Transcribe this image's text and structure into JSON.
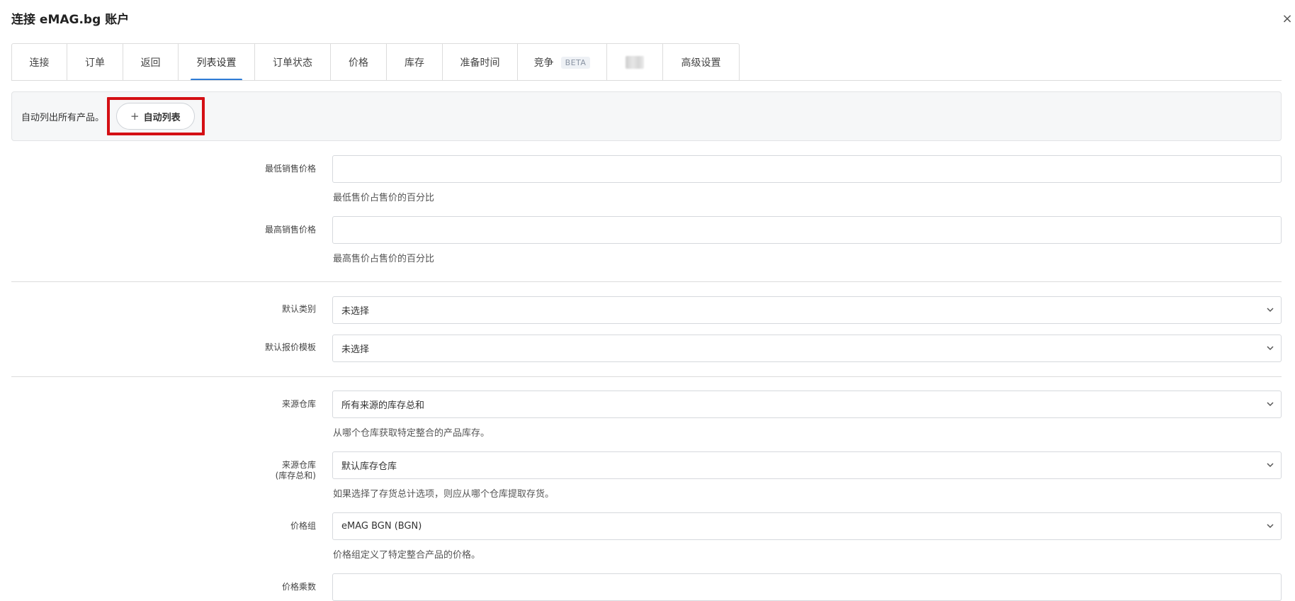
{
  "window": {
    "title": "连接 eMAG.bg 账户",
    "close": "×"
  },
  "tabs": [
    {
      "label": "连接"
    },
    {
      "label": "订单"
    },
    {
      "label": "返回"
    },
    {
      "label": "列表设置"
    },
    {
      "label": "订单状态"
    },
    {
      "label": "价格"
    },
    {
      "label": "库存"
    },
    {
      "label": "准备时间"
    },
    {
      "label": "竞争",
      "badge": "BETA"
    },
    {
      "label": ""
    },
    {
      "label": "高级设置"
    }
  ],
  "active_tab": "列表设置",
  "autolist": {
    "text": "自动列出所有产品。",
    "button_plus": "+",
    "button_label": "自动列表"
  },
  "form": {
    "min_price": {
      "label": "最低销售价格",
      "value": "",
      "help": "最低售价占售价的百分比"
    },
    "max_price": {
      "label": "最高销售价格",
      "value": "",
      "help": "最高售价占售价的百分比"
    },
    "default_category": {
      "label": "默认类别",
      "value": "未选择"
    },
    "default_offer_template": {
      "label": "默认报价模板",
      "value": "未选择"
    },
    "source_warehouse": {
      "label": "来源仓库",
      "value": "所有来源的库存总和",
      "help": "从哪个仓库获取特定整合的产品库存。"
    },
    "source_warehouse_total": {
      "label_line1": "来源仓库",
      "label_line2": "(库存总和)",
      "value": "默认库存仓库",
      "help": "如果选择了存货总计选项，则应从哪个仓库提取存货。"
    },
    "price_group": {
      "label": "价格组",
      "value": "eMAG BGN (BGN)",
      "help": "价格组定义了特定整合产品的价格。"
    },
    "price_multiplier": {
      "label": "价格乘数",
      "value": ""
    }
  },
  "colors": {
    "accent": "#2e7bd6",
    "highlight": "#d40f14"
  }
}
